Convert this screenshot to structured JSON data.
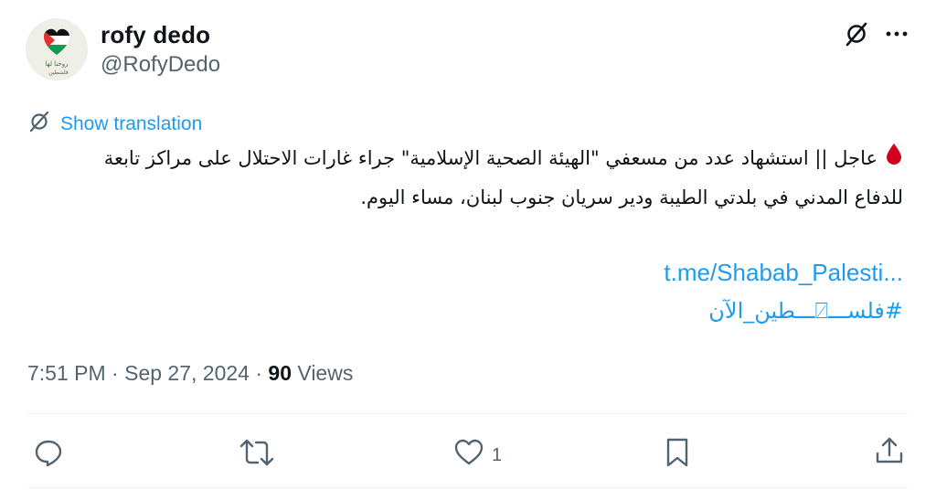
{
  "user": {
    "display_name": "rofy dedo",
    "handle": "@RofyDedo",
    "avatar_icon": "avatar-palestine-flag-heart"
  },
  "top_actions": {
    "grok_icon": "grok-icon",
    "more_icon": "more-icon"
  },
  "translation": {
    "label": "Show translation",
    "icon": "translate-icon"
  },
  "tweet": {
    "line1": "عاجل || استشهاد عدد من مسعفي \"الهيئة الصحية الإسلامية\" جراء غارات الاحتلال على مراكز تابعة",
    "line2": "للدفاع المدني في بلدتي الطيبة ودير سريان جنوب لبنان، مساء اليوم.",
    "link": "t.me/Shabab_Palesti...",
    "hashtag": "#فلســـ⍁ـــطين_الآن"
  },
  "meta": {
    "time": "7:51 PM",
    "separator": "·",
    "date": "Sep 27, 2024",
    "views_count": "90",
    "views_label": "Views"
  },
  "actions": {
    "reply_icon": "reply-icon",
    "retweet_icon": "retweet-icon",
    "like_icon": "heart-icon",
    "like_count": "1",
    "bookmark_icon": "bookmark-icon",
    "share_icon": "share-icon"
  },
  "colors": {
    "accent": "#1d9bf0",
    "secondary_text": "#536471",
    "primary_text": "#0f1419",
    "blood_drop": "#d0021b"
  }
}
